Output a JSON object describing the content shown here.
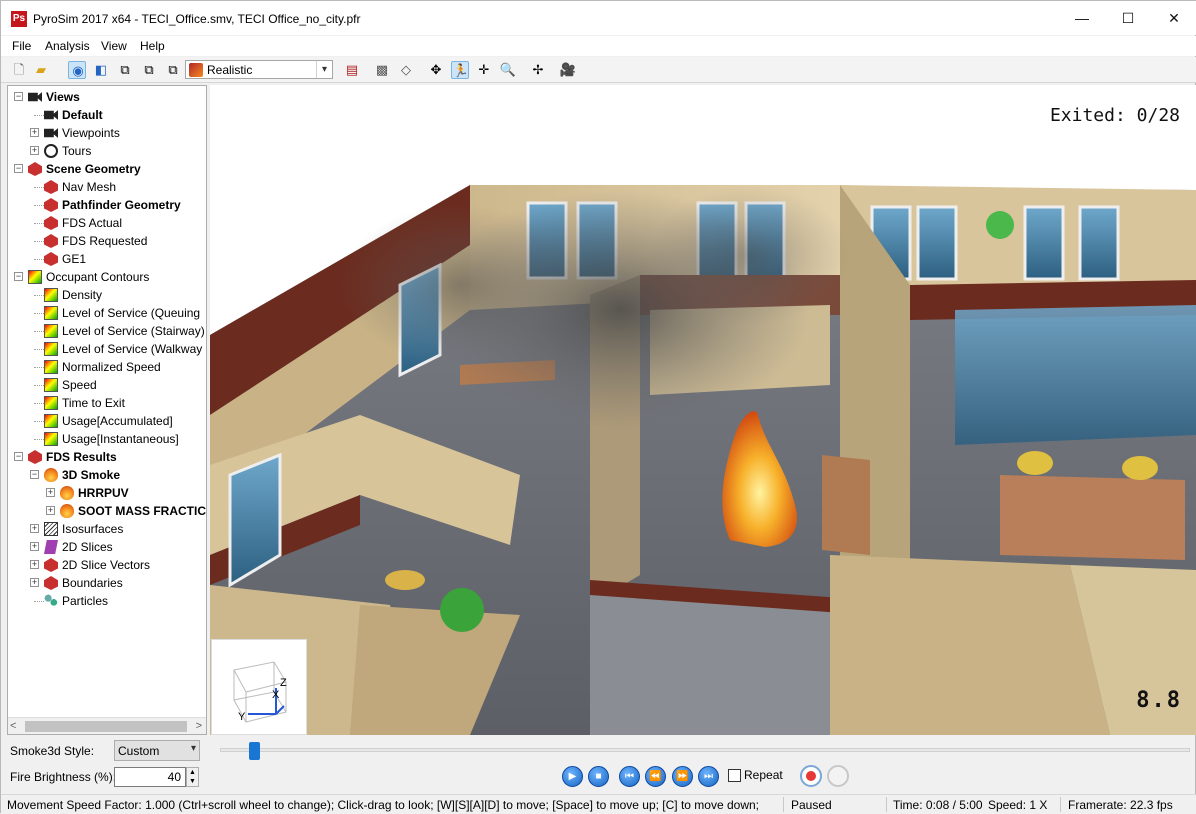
{
  "window": {
    "title": "PyroSim 2017 x64 - TECI_Office.smv, TECI Office_no_city.pfr",
    "app_icon_text": "Ps",
    "controls": {
      "minimize": "—",
      "maximize": "☐",
      "close": "✕"
    }
  },
  "menu": [
    {
      "label": "File",
      "mnemonic": "F"
    },
    {
      "label": "Analysis",
      "mnemonic": "A"
    },
    {
      "label": "View",
      "mnemonic": "V"
    },
    {
      "label": "Help",
      "mnemonic": "H"
    }
  ],
  "toolbar": {
    "render_mode": "Realistic",
    "tools": [
      "new-file-icon",
      "open-folder-icon",
      "hide-icon",
      "walk-icon",
      "wireframe-icon",
      "solid-icon",
      "outline-icon",
      "texture-icon",
      "render-mode-icon",
      "color-scale-icon",
      "smooth-icon",
      "vertices-icon",
      "orbit-icon",
      "roam-icon",
      "pan-icon",
      "zoom-icon",
      "reset-view-icon",
      "camera-icon"
    ]
  },
  "tree": {
    "nodes": [
      {
        "label": "Views",
        "bold": true,
        "level": 0,
        "icon": "camera-icon",
        "expander": "−"
      },
      {
        "label": "Default",
        "bold": true,
        "level": 1,
        "icon": "camera-icon",
        "expander": ""
      },
      {
        "label": "Viewpoints",
        "bold": false,
        "level": 1,
        "icon": "camera-icon",
        "expander": "+"
      },
      {
        "label": "Tours",
        "bold": false,
        "level": 1,
        "icon": "tour-icon",
        "expander": "+"
      },
      {
        "label": "Scene Geometry",
        "bold": true,
        "level": 0,
        "icon": "geometry-icon",
        "expander": "−"
      },
      {
        "label": "Nav Mesh",
        "bold": false,
        "level": 1,
        "icon": "geometry-icon",
        "expander": ""
      },
      {
        "label": "Pathfinder Geometry",
        "bold": true,
        "level": 1,
        "icon": "geometry-icon",
        "expander": ""
      },
      {
        "label": "FDS Actual",
        "bold": false,
        "level": 1,
        "icon": "geometry-icon",
        "expander": ""
      },
      {
        "label": "FDS Requested",
        "bold": false,
        "level": 1,
        "icon": "geometry-icon",
        "expander": ""
      },
      {
        "label": "GE1",
        "bold": false,
        "level": 1,
        "icon": "geometry-icon",
        "expander": ""
      },
      {
        "label": "Occupant Contours",
        "bold": false,
        "level": 0,
        "icon": "contour-icon",
        "expander": "−"
      },
      {
        "label": "Density",
        "bold": false,
        "level": 1,
        "icon": "contour-icon",
        "expander": ""
      },
      {
        "label": "Level of Service (Queuing",
        "bold": false,
        "level": 1,
        "icon": "contour-icon",
        "expander": ""
      },
      {
        "label": "Level of Service (Stairway)",
        "bold": false,
        "level": 1,
        "icon": "contour-icon",
        "expander": ""
      },
      {
        "label": "Level of Service (Walkway",
        "bold": false,
        "level": 1,
        "icon": "contour-icon",
        "expander": ""
      },
      {
        "label": "Normalized Speed",
        "bold": false,
        "level": 1,
        "icon": "contour-icon",
        "expander": ""
      },
      {
        "label": "Speed",
        "bold": false,
        "level": 1,
        "icon": "contour-icon",
        "expander": ""
      },
      {
        "label": "Time to Exit",
        "bold": false,
        "level": 1,
        "icon": "contour-icon",
        "expander": ""
      },
      {
        "label": "Usage[Accumulated]",
        "bold": false,
        "level": 1,
        "icon": "contour-icon",
        "expander": ""
      },
      {
        "label": "Usage[Instantaneous]",
        "bold": false,
        "level": 1,
        "icon": "contour-icon",
        "expander": ""
      },
      {
        "label": "FDS Results",
        "bold": true,
        "level": 0,
        "icon": "geometry-icon",
        "expander": "−"
      },
      {
        "label": "3D Smoke",
        "bold": true,
        "level": 1,
        "icon": "fire-icon",
        "expander": "−"
      },
      {
        "label": "HRRPUV",
        "bold": true,
        "level": 2,
        "icon": "fire-icon",
        "expander": "+"
      },
      {
        "label": "SOOT MASS FRACTIC",
        "bold": true,
        "level": 2,
        "icon": "fire-icon",
        "expander": "+"
      },
      {
        "label": "Isosurfaces",
        "bold": false,
        "level": 1,
        "icon": "isosurface-icon",
        "expander": "+"
      },
      {
        "label": "2D Slices",
        "bold": false,
        "level": 1,
        "icon": "slice-icon",
        "expander": "+"
      },
      {
        "label": "2D Slice Vectors",
        "bold": false,
        "level": 1,
        "icon": "geometry-icon",
        "expander": "+"
      },
      {
        "label": "Boundaries",
        "bold": false,
        "level": 1,
        "icon": "geometry-icon",
        "expander": "+"
      },
      {
        "label": "Particles",
        "bold": false,
        "level": 1,
        "icon": "particles-icon",
        "expander": ""
      }
    ],
    "scroll_left": "<",
    "scroll_right": ">"
  },
  "viewport": {
    "exited_label": "Exited:",
    "exited_value": "0/28",
    "time_display": "8.8",
    "axes": {
      "z": "Z",
      "x": "X",
      "y": "Y"
    },
    "scene_description_colors": {
      "wall": "#d8c39a",
      "carpet": "#7a7d86",
      "window": "#3d7fa6",
      "fire": "#f5a623",
      "trim": "#6b2c1f"
    }
  },
  "controls": {
    "smoke_style_label": "Smoke3d Style:",
    "smoke_style_value": "Custom",
    "fire_brightness_label": "Fire Brightness (%):",
    "fire_brightness_value": "40",
    "time_progress": 0.03,
    "repeat_label": "Repeat",
    "repeat_checked": false,
    "playback": [
      "play",
      "stop",
      "skip-start",
      "rewind",
      "fast-forward",
      "skip-end"
    ]
  },
  "status": {
    "hint": "Movement Speed Factor: 1.000 (Ctrl+scroll wheel to change); Click-drag to look; [W][S][A][D] to move; [Space] to move up; [C] to move down;",
    "state": "Paused",
    "time": "Time: 0:08 / 5:00",
    "speed": "Speed: 1 X",
    "framerate": "Framerate: 22.3 fps"
  }
}
